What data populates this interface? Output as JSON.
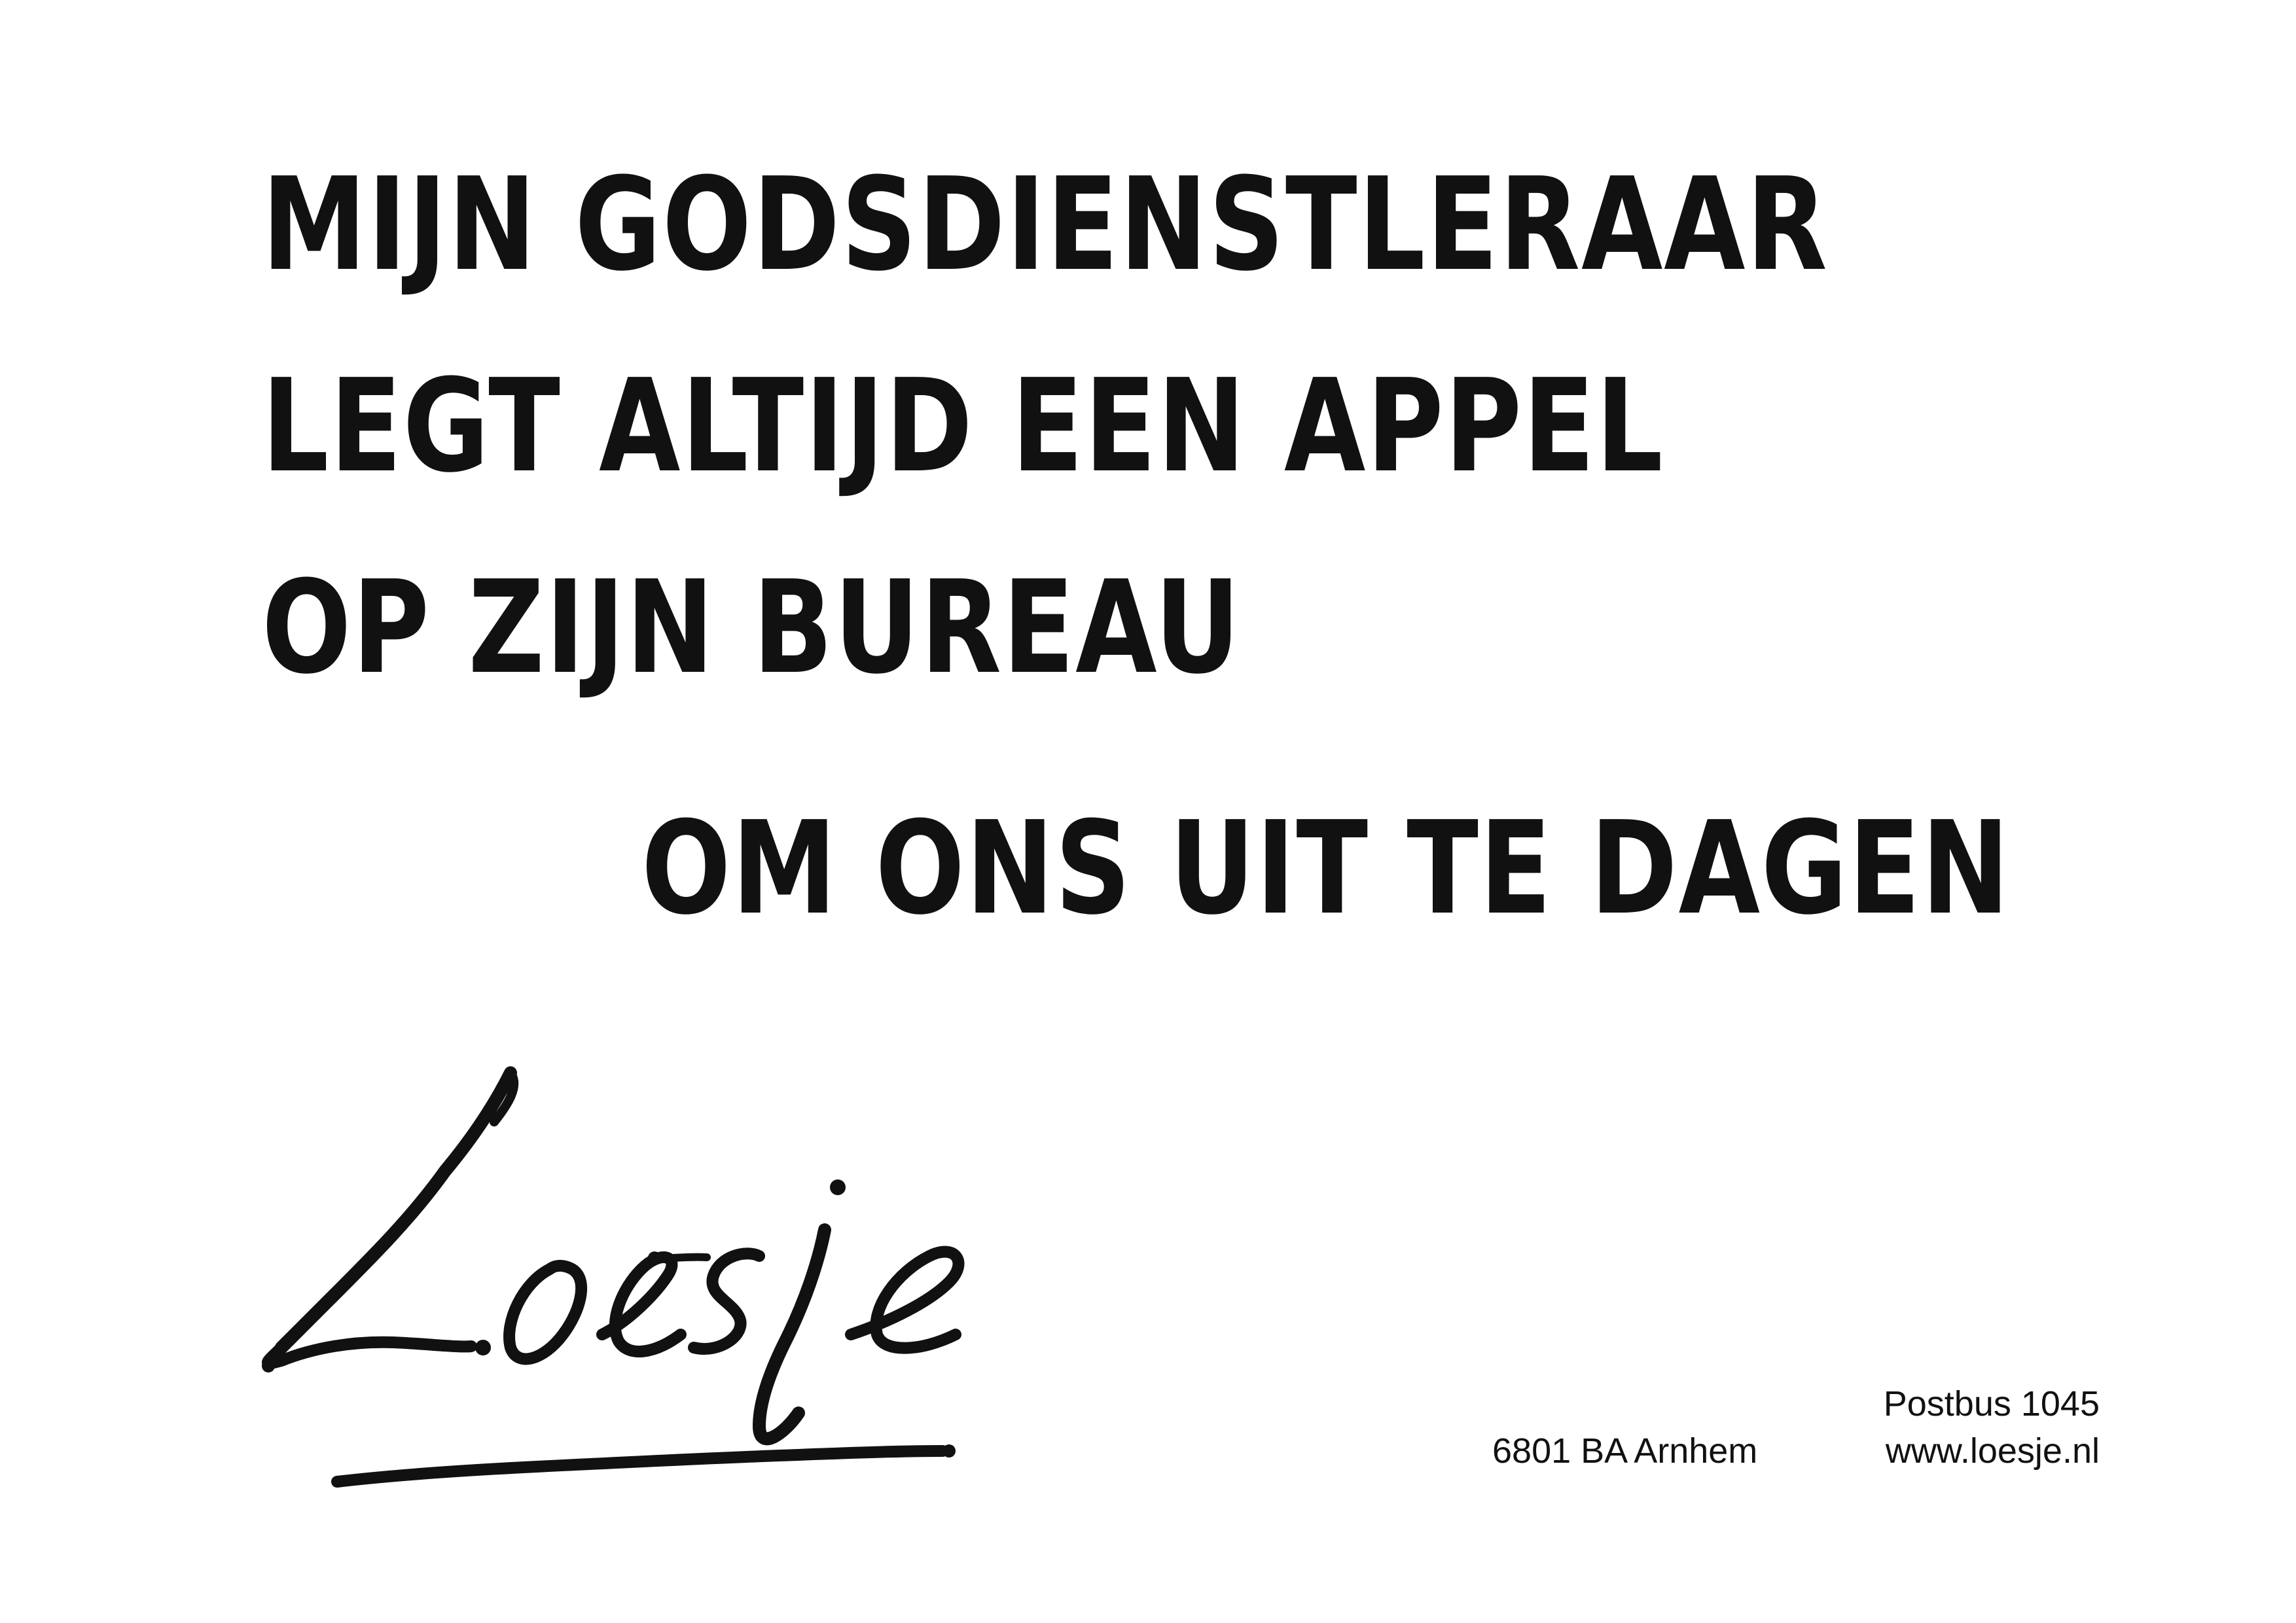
{
  "poster": {
    "headline_lines": [
      "MIJN GODSDIENSTLERAAR",
      "LEGT ALTIJD EEN APPEL",
      "OP ZIJN BUREAU"
    ],
    "punchline": "OM ONS UIT TE DAGEN",
    "logo_text": "Loesje",
    "address": {
      "postbus": "Postbus 1045",
      "city": "6801 BA Arnhem",
      "website": "www.loesje.nl"
    }
  },
  "colors": {
    "text": "#111111",
    "background": "#ffffff"
  }
}
